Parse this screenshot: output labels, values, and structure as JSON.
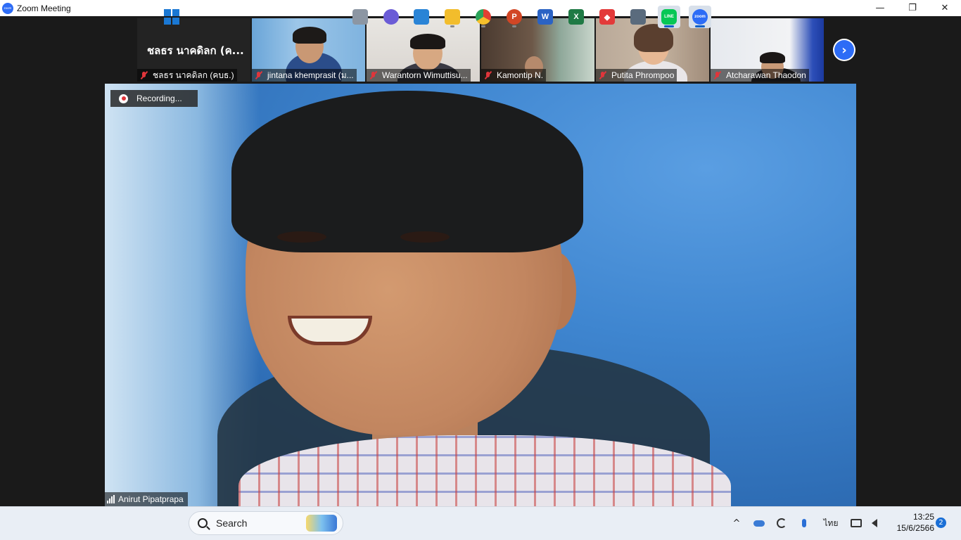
{
  "window": {
    "title": "Zoom Meeting",
    "minimize_glyph": "—",
    "restore_glyph": "❐",
    "close_glyph": "✕"
  },
  "recording": {
    "label": "Recording..."
  },
  "self_tile": {
    "display_name": "ชลธร นาคดิลก (ค...",
    "label": "ชลธร นาคดิลก (คบธ.)"
  },
  "participants": [
    {
      "name": "jintana khemprasit (ม..."
    },
    {
      "name": "Warantorn Wimuttisu..."
    },
    {
      "name": "Kamontip N."
    },
    {
      "name": "Putita Phrompoo"
    },
    {
      "name": "Atcharawan Thaodon"
    }
  ],
  "next_page_glyph": "›",
  "speaker": {
    "name": "Anirut Pipatprapa"
  },
  "taskbar": {
    "search_label": "Search",
    "apps": [
      {
        "name": "task-view",
        "glyph": ""
      },
      {
        "name": "meet-now",
        "glyph": ""
      },
      {
        "name": "microsoft-store",
        "glyph": ""
      },
      {
        "name": "file-explorer",
        "glyph": ""
      },
      {
        "name": "chrome",
        "glyph": ""
      },
      {
        "name": "powerpoint",
        "glyph": "P"
      },
      {
        "name": "word",
        "glyph": "W"
      },
      {
        "name": "excel",
        "glyph": "X"
      },
      {
        "name": "anydesk",
        "glyph": "◆"
      },
      {
        "name": "calculator",
        "glyph": ""
      },
      {
        "name": "line",
        "glyph": "LINE"
      },
      {
        "name": "zoom",
        "glyph": "zoom"
      }
    ],
    "tray": {
      "chevron": "^",
      "language": "ไทย",
      "time": "13:25",
      "date": "15/6/2566",
      "notifications": "2"
    }
  },
  "colors": {
    "zoom_blue": "#2d6cf6",
    "muted_red": "#e0353b",
    "meeting_bg": "#1a1a1a"
  }
}
